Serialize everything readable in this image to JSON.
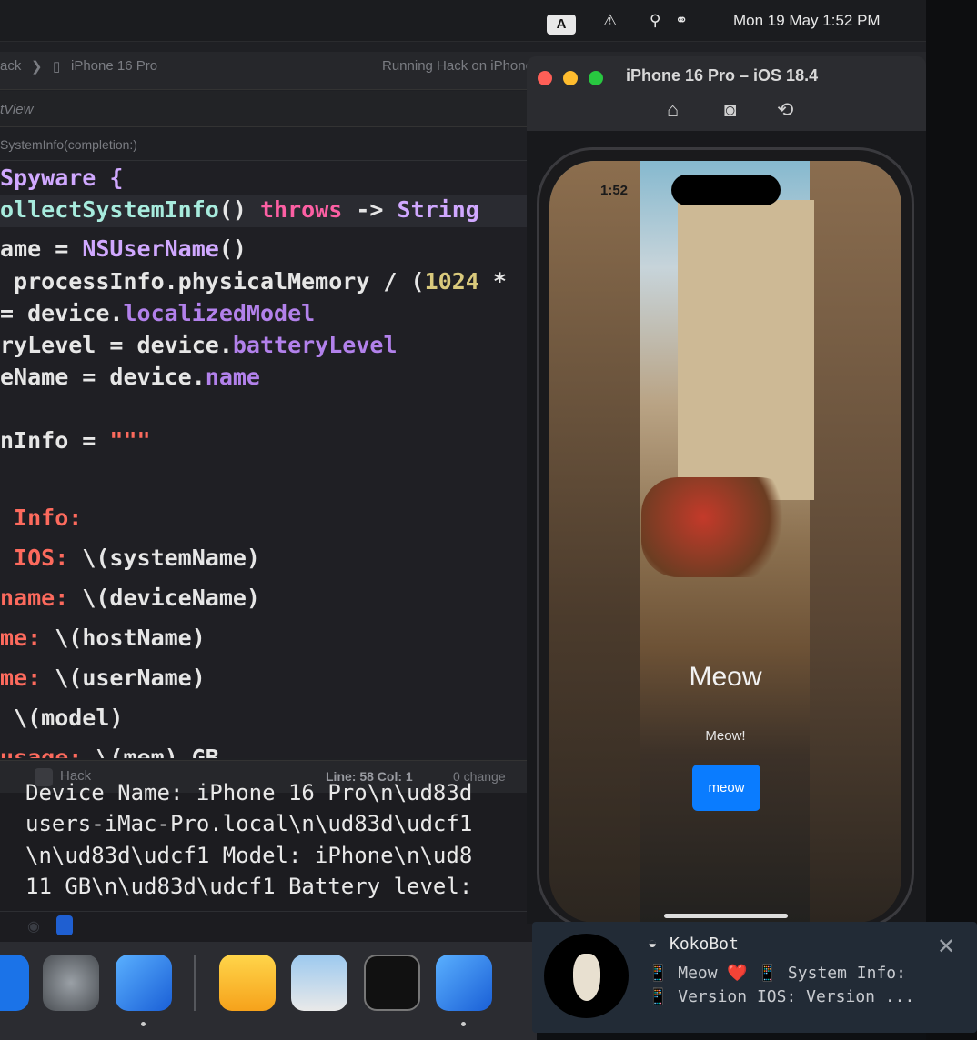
{
  "menubar": {
    "input_source": "A",
    "date_time": "Mon 19 May  1:52 PM"
  },
  "toolbar": {
    "scheme": "ack",
    "device": "iPhone 16 Pro",
    "status": "Running Hack on iPhone"
  },
  "jumpbar": {
    "file": "tView"
  },
  "breadcrumb": {
    "symbol": "SystemInfo(completion:)"
  },
  "editor": {
    "lines": [
      {
        "parts": [
          {
            "t": "Spyware {",
            "c": "ty"
          }
        ]
      },
      {
        "parts": [
          {
            "t": "ollectSystemInfo",
            "c": "fn"
          },
          {
            "t": "() ",
            "c": "plain"
          },
          {
            "t": "throws",
            "c": "kw"
          },
          {
            "t": " -> ",
            "c": "plain"
          },
          {
            "t": "String",
            "c": "ty"
          }
        ]
      },
      {
        "parts": [
          {
            "t": "ame = ",
            "c": "plain"
          },
          {
            "t": "NSUserName",
            "c": "ty"
          },
          {
            "t": "()",
            "c": "plain"
          }
        ]
      },
      {
        "parts": [
          {
            "t": " processInfo.physicalMemory / (",
            "c": "plain"
          },
          {
            "t": "1024",
            "c": "num"
          },
          {
            "t": " *",
            "c": "plain"
          }
        ]
      },
      {
        "parts": [
          {
            "t": "= device.",
            "c": "plain"
          },
          {
            "t": "localizedModel",
            "c": "pr"
          }
        ]
      },
      {
        "parts": [
          {
            "t": "ryLevel = device.",
            "c": "plain"
          },
          {
            "t": "batteryLevel",
            "c": "pr"
          }
        ]
      },
      {
        "parts": [
          {
            "t": "eName = device.",
            "c": "plain"
          },
          {
            "t": "name",
            "c": "pr"
          }
        ]
      },
      {
        "parts": [
          {
            "t": "",
            "c": "plain"
          }
        ]
      },
      {
        "parts": [
          {
            "t": "nInfo = ",
            "c": "plain"
          },
          {
            "t": "\"\"\"",
            "c": "str"
          }
        ]
      },
      {
        "parts": [
          {
            "t": "",
            "c": "str"
          }
        ]
      },
      {
        "parts": [
          {
            "t": " Info:",
            "c": "lbl"
          }
        ]
      },
      {
        "parts": [
          {
            "t": " IOS: ",
            "c": "lbl"
          },
          {
            "t": "\\(systemName)",
            "c": "plain"
          }
        ]
      },
      {
        "parts": [
          {
            "t": "name: ",
            "c": "lbl"
          },
          {
            "t": "\\(deviceName)",
            "c": "plain"
          }
        ]
      },
      {
        "parts": [
          {
            "t": "me: ",
            "c": "lbl"
          },
          {
            "t": "\\(hostName)",
            "c": "plain"
          }
        ]
      },
      {
        "parts": [
          {
            "t": "me: ",
            "c": "lbl"
          },
          {
            "t": "\\(userName)",
            "c": "plain"
          }
        ]
      },
      {
        "parts": [
          {
            "t": " \\(model)",
            "c": "plain"
          }
        ]
      },
      {
        "parts": [
          {
            "t": "usage: ",
            "c": "lbl"
          },
          {
            "t": "\\(mem) GB",
            "c": "plain"
          }
        ]
      }
    ]
  },
  "statusbar": {
    "target": "Hack",
    "position": "Line: 58  Col: 1",
    "changes": "0 change"
  },
  "console": {
    "lines": [
      "Device Name: iPhone 16 Pro\\n\\ud83d",
      "users-iMac-Pro.local\\n\\ud83d\\udcf1",
      "\\n\\ud83d\\udcf1 Model: iPhone\\n\\ud8",
      "11 GB\\n\\ud83d\\udcf1 Battery level:"
    ]
  },
  "simulator": {
    "title": "iPhone 16 Pro – iOS 18.4",
    "clock": "1:52"
  },
  "app": {
    "title": "Meow",
    "subtitle": "Meow!",
    "button": "meow",
    "button_color": "#0a7cff"
  },
  "notification": {
    "sender": "KokoBot",
    "line1": "📱 Meow ❤️ 📱 System Info:",
    "line2": "📱 Version IOS: Version ..."
  }
}
